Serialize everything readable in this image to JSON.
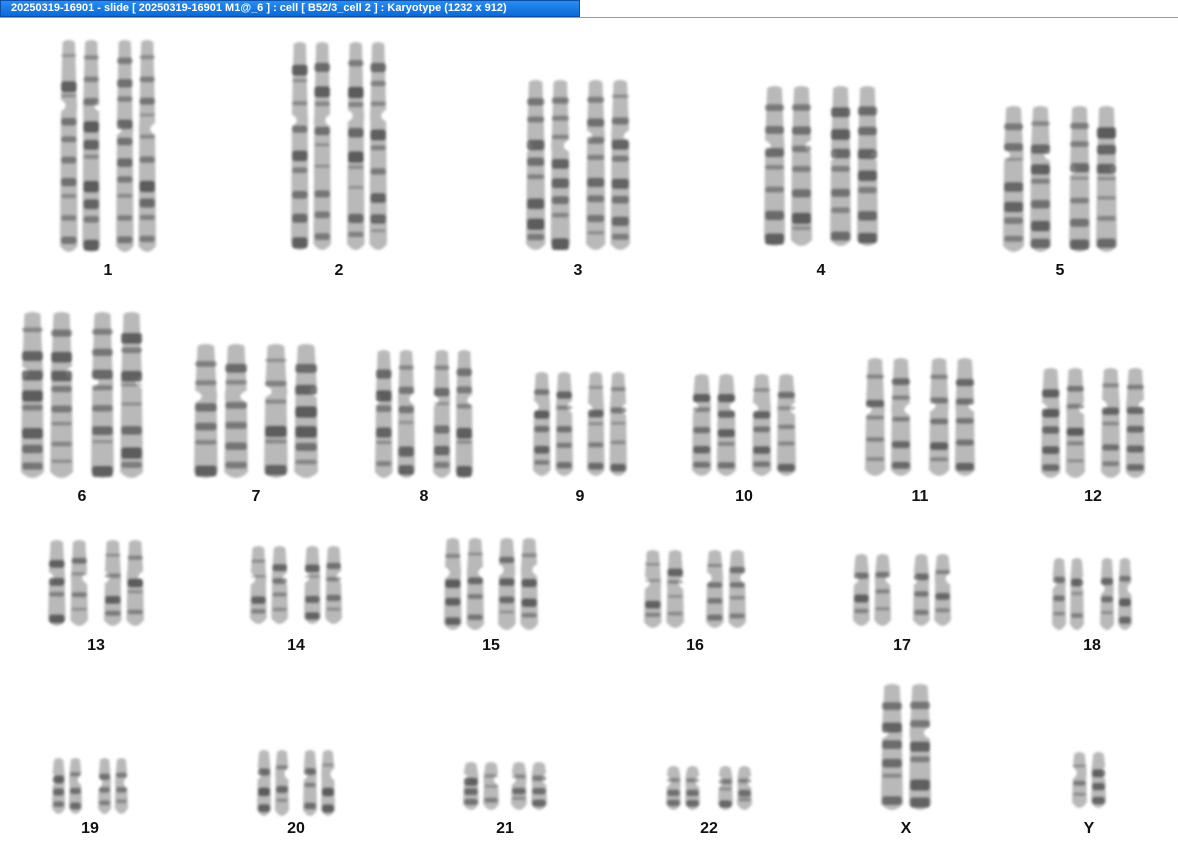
{
  "window": {
    "title": "20250319-16901 - slide [ 20250319-16901 M1@_6 ] : cell [ B52/3_cell 2 ] : Karyotype  (1232 x 912)"
  },
  "karyotype": {
    "groups": [
      {
        "label": "1",
        "count": 2
      },
      {
        "label": "2",
        "count": 2
      },
      {
        "label": "3",
        "count": 2
      },
      {
        "label": "4",
        "count": 2
      },
      {
        "label": "5",
        "count": 2
      },
      {
        "label": "6",
        "count": 2
      },
      {
        "label": "7",
        "count": 2
      },
      {
        "label": "8",
        "count": 2
      },
      {
        "label": "9",
        "count": 2
      },
      {
        "label": "10",
        "count": 2
      },
      {
        "label": "11",
        "count": 2
      },
      {
        "label": "12",
        "count": 2
      },
      {
        "label": "13",
        "count": 2
      },
      {
        "label": "14",
        "count": 2
      },
      {
        "label": "15",
        "count": 2
      },
      {
        "label": "16",
        "count": 2
      },
      {
        "label": "17",
        "count": 2
      },
      {
        "label": "18",
        "count": 2
      },
      {
        "label": "19",
        "count": 2
      },
      {
        "label": "20",
        "count": 2
      },
      {
        "label": "21",
        "count": 2
      },
      {
        "label": "22",
        "count": 2
      },
      {
        "label": "X",
        "count": 1
      },
      {
        "label": "Y",
        "count": 1
      }
    ]
  },
  "colors": {
    "title_bar": "#0a6ad8",
    "chromosome_body": "#b9b9b9",
    "chromosome_band": "#4a4a4a"
  }
}
